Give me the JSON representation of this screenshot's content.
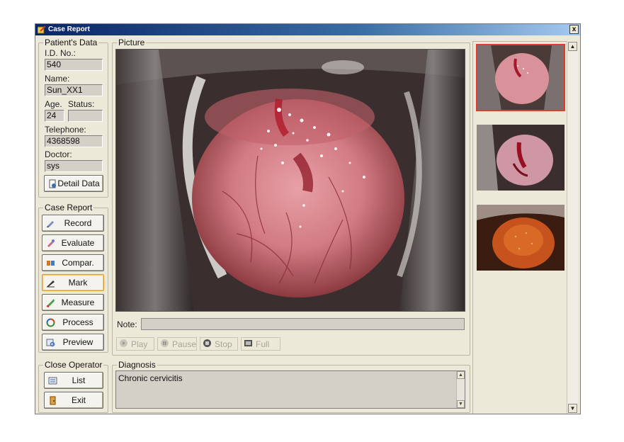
{
  "window": {
    "title": "Case Report",
    "close_label": "x"
  },
  "patient": {
    "legend": "Patient's Data",
    "id_label": "I.D.  No.:",
    "id_value": "540",
    "name_label": "Name:",
    "name_value": "Sun_XX1",
    "age_label": "Age.",
    "status_label": "Status:",
    "age_value": "24",
    "status_value": "",
    "telephone_label": "Telephone:",
    "telephone_value": "4368598",
    "doctor_label": "Doctor:",
    "doctor_value": "sys",
    "detail_button": "Detail Data"
  },
  "case_report": {
    "legend": "Case Report",
    "buttons": [
      {
        "label": "Record",
        "icon": "record-icon"
      },
      {
        "label": "Evaluate",
        "icon": "evaluate-icon"
      },
      {
        "label": "Compar.",
        "icon": "compare-icon"
      },
      {
        "label": "Mark",
        "icon": "pen-icon"
      },
      {
        "label": "Measure",
        "icon": "ruler-icon"
      },
      {
        "label": "Process",
        "icon": "process-icon"
      },
      {
        "label": "Preview",
        "icon": "preview-icon"
      }
    ]
  },
  "close_operator": {
    "legend": "Close Operator",
    "list_label": "List",
    "exit_label": "Exit"
  },
  "picture": {
    "legend": "Picture",
    "note_label": "Note:",
    "note_value": "",
    "media": {
      "play": "Play",
      "pause": "Pause",
      "stop": "Stop",
      "full": "Full"
    }
  },
  "diagnosis": {
    "legend": "Diagnosis",
    "text": "Chronic cervicitis"
  },
  "colors": {
    "selected_thumb_border": "#e43a2a",
    "titlebar": "#0a246a",
    "panel": "#ece9d8"
  }
}
